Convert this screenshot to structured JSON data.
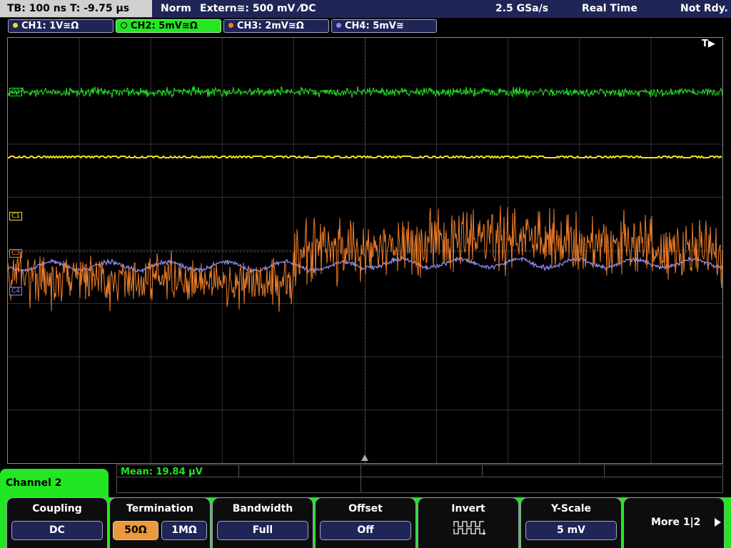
{
  "status_bar": {
    "timebase": "TB: 100 ns   T: -9.75 µs",
    "mode": "Norm",
    "trigger": "Extern≅: 500 mV ⁄DC",
    "sample_rate": "2.5 GSa/s",
    "acquisition": "Real Time",
    "state": "Not Rdy."
  },
  "channels": [
    {
      "label": "CH1: 1V≅Ω",
      "color": "#f0e020",
      "active": false
    },
    {
      "label": "CH2: 5mV≅Ω",
      "color": "#22e622",
      "active": true
    },
    {
      "label": "CH3: 2mV≅Ω",
      "color": "#ef7f2a",
      "active": false
    },
    {
      "label": "CH4: 5mV≅",
      "color": "#8a8aee",
      "active": false
    }
  ],
  "markers": {
    "trigger": "T▶",
    "c1": "C1",
    "c2": "C2",
    "c3": "C3",
    "c4": "C4"
  },
  "measurement": {
    "label": "Mean: 19.84 µV"
  },
  "menu": {
    "title": "Channel 2",
    "coupling": {
      "title": "Coupling",
      "value": "DC"
    },
    "termination": {
      "title": "Termination",
      "option_50": "50Ω",
      "option_1m": "1MΩ",
      "selected": "50Ω"
    },
    "bandwidth": {
      "title": "Bandwidth",
      "value": "Full"
    },
    "offset": {
      "title": "Offset",
      "value": "Off"
    },
    "invert": {
      "title": "Invert",
      "icon": "inverted-square-wave-icon"
    },
    "yscale": {
      "title": "Y-Scale",
      "value": "5 mV"
    },
    "more": {
      "label": "More 1|2",
      "icon": "right-triangle-icon"
    }
  }
}
